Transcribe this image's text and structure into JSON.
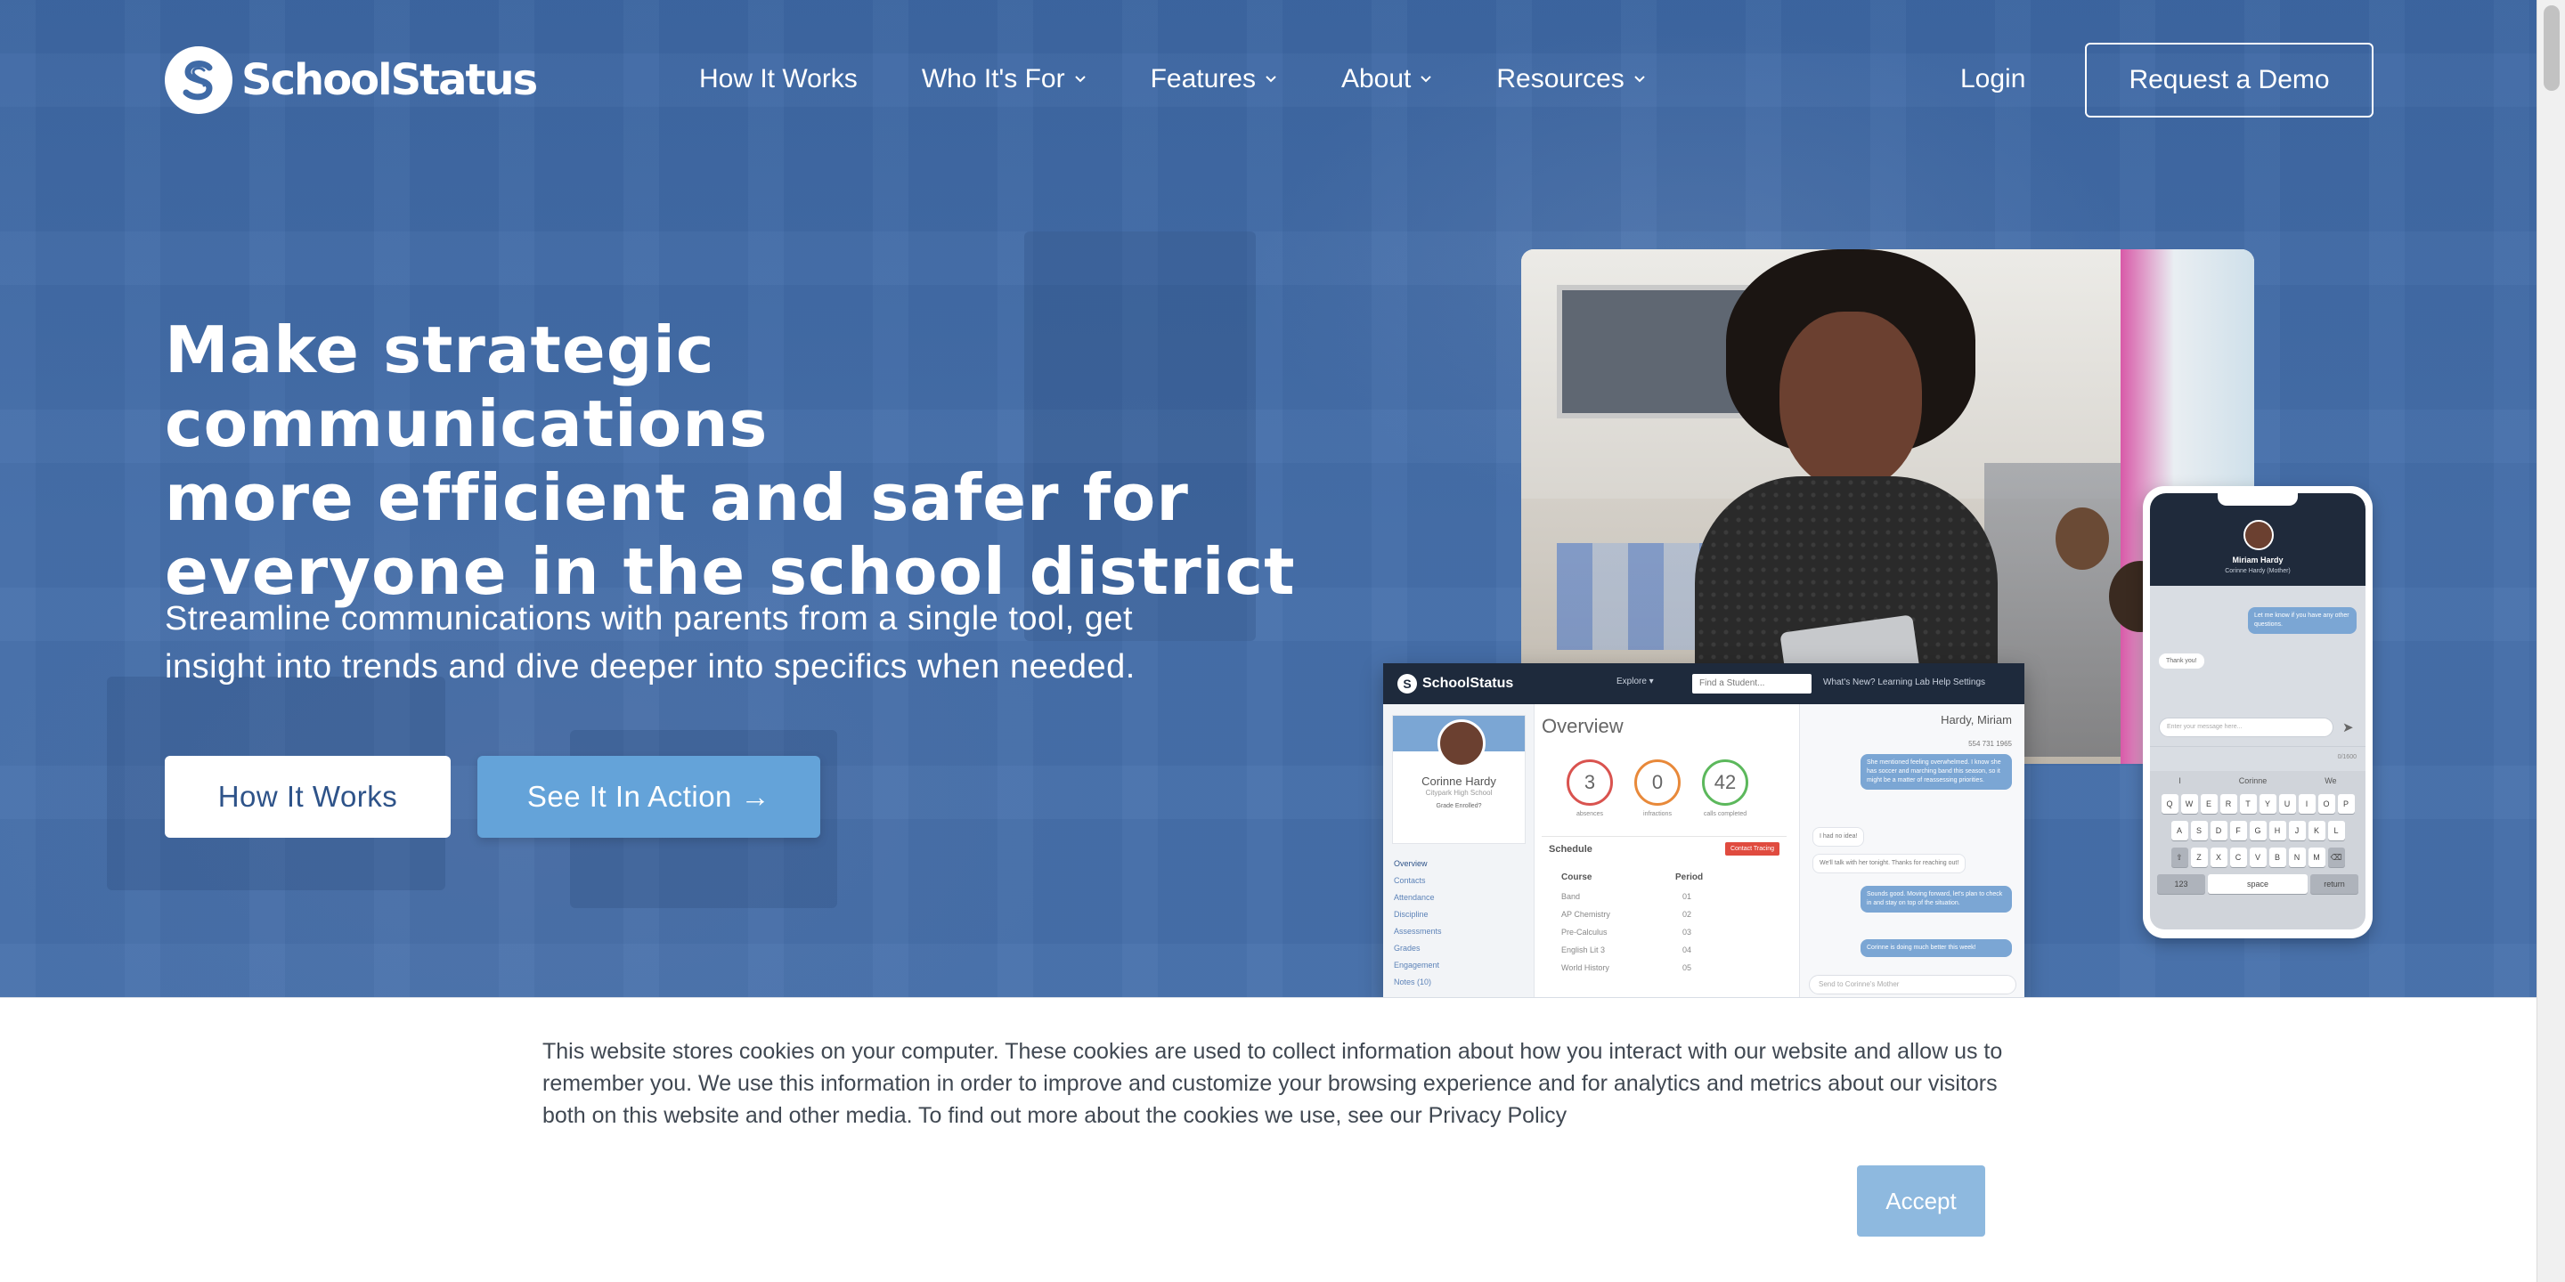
{
  "brand": {
    "name": "SchoolStatus",
    "logo_icon": "schoolstatus-s-logo"
  },
  "nav": {
    "items": [
      {
        "label": "How It Works",
        "has_dropdown": false
      },
      {
        "label": "Who It's For",
        "has_dropdown": true
      },
      {
        "label": "Features",
        "has_dropdown": true
      },
      {
        "label": "About",
        "has_dropdown": true
      },
      {
        "label": "Resources",
        "has_dropdown": true
      }
    ],
    "login_label": "Login",
    "demo_label": "Request a Demo"
  },
  "hero": {
    "headline_lines": [
      "Make strategic communications",
      "more efficient and safer for",
      "everyone in the school district"
    ],
    "subtext_lines": [
      "Streamline communications with parents from a single tool, get",
      "insight into trends and dive deeper into specifics when needed."
    ],
    "primary_button": "How It Works",
    "secondary_button": "See It In Action →"
  },
  "dashboard_mock": {
    "brand": "SchoolStatus",
    "explore": "Explore ▾",
    "search_placeholder": "Find a Student...",
    "links": "What's New?   Learning Lab   Help   Settings",
    "student_name": "Corinne Hardy",
    "school": "Citypark High School",
    "meta": "Grade   Enrolled?",
    "menu": [
      "Overview",
      "Contacts",
      "Attendance",
      "Discipline",
      "Assessments",
      "Grades",
      "Engagement",
      "Notes (10)"
    ],
    "overview_title": "Overview",
    "stats": [
      {
        "value": "3",
        "label": "absences",
        "color": "#d9534f"
      },
      {
        "value": "0",
        "label": "infractions",
        "color": "#e8893a"
      },
      {
        "value": "42",
        "label": "calls completed",
        "color": "#5cb85c"
      }
    ],
    "schedule_title": "Schedule",
    "tracing_tag": "Contact Tracing",
    "schedule_headers": [
      "Course",
      "Period"
    ],
    "schedule_rows": [
      {
        "course": "Band",
        "period": "01"
      },
      {
        "course": "AP Chemistry",
        "period": "02"
      },
      {
        "course": "Pre-Calculus",
        "period": "03"
      },
      {
        "course": "English Lit 3",
        "period": "04"
      },
      {
        "course": "World History",
        "period": "05"
      }
    ],
    "chat_name": "Hardy, Miriam",
    "chat_phone": "554 731 1965",
    "chat_messages": [
      {
        "dir": "out",
        "text": "She mentioned feeling overwhelmed. I know she has soccer and marching band this season, so it might be a matter of reassessing priorities."
      },
      {
        "dir": "in",
        "text": "I had no idea!"
      },
      {
        "dir": "in",
        "text": "We'll talk with her tonight. Thanks for reaching out!"
      },
      {
        "dir": "out",
        "text": "Sounds good. Moving forward, let's plan to check in and stay on top of the situation."
      },
      {
        "dir": "out",
        "text": "Corinne is doing much better this week!"
      }
    ],
    "chat_input": "Send to Corinne's Mother"
  },
  "phone_mock": {
    "contact_name": "Miriam Hardy",
    "contact_relation": "Corinne Hardy (Mother)",
    "message_out": "Let me know if you have any other questions.",
    "message_in": "Thank you!",
    "input_placeholder": "Enter your message here...",
    "char_count": "0/1600",
    "suggestions": [
      "I",
      "Corinne",
      "We"
    ],
    "keyboard_rows": [
      [
        "Q",
        "W",
        "E",
        "R",
        "T",
        "Y",
        "U",
        "I",
        "O",
        "P"
      ],
      [
        "A",
        "S",
        "D",
        "F",
        "G",
        "H",
        "J",
        "K",
        "L"
      ],
      [
        "⇧",
        "Z",
        "X",
        "C",
        "V",
        "B",
        "N",
        "M",
        "⌫"
      ]
    ],
    "key_123": "123",
    "key_space": "space",
    "key_return": "return"
  },
  "cookie": {
    "lines": [
      "This website stores cookies on your computer. These cookies are used to collect information about how you interact with our website and allow us to",
      "remember you. We use this information in order to improve and customize your browsing experience and for analytics and metrics about our visitors",
      "both on this website and other media. To find out more about the cookies we use, see our Privacy Policy"
    ],
    "accept_label": "Accept"
  },
  "colors": {
    "hero_bg": "#3f6aa6",
    "accent": "#64a3d9",
    "accept_bg": "#8eb9df",
    "brand_text": "#2e5389"
  }
}
